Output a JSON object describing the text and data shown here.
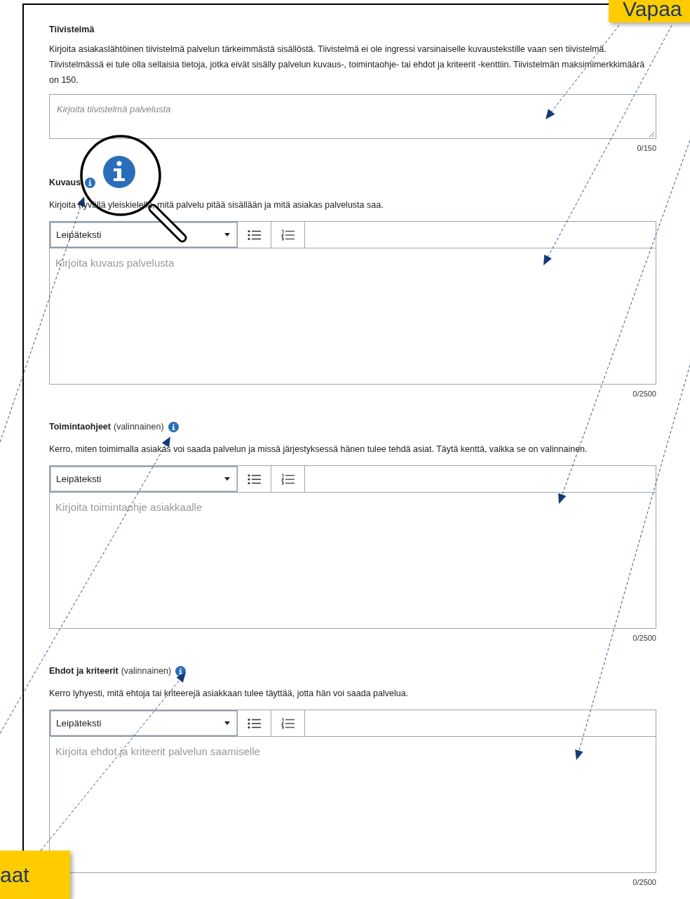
{
  "sections": [
    {
      "title": "Tiivistelmä",
      "info": false,
      "description": "Kirjoita asiakaslähtöinen tiivistelmä palvelun tärkeimmästä sisällöstä. Tiivistelmä ei ole ingressi varsinaiselle kuvaustekstille vaan sen tiivistelmä. Tiivistelmässä ei tule olla sellaisia tietoja, jotka eivät sisälly palvelun kuvaus-, toimintaohje- tai ehdot ja kriteerit -kenttiin. Tiivistelmän maksimimerkkimäärä on 150.",
      "kind": "textarea",
      "placeholder": "Kirjoita tiivistelmä palvelusta",
      "counter": "0/150"
    },
    {
      "title": "Kuvaus",
      "info": true,
      "description": "Kirjoita hyvällä yleiskielellä, mitä palvelu pitää sisällään ja mitä asiakas palvelusta saa.",
      "kind": "rich_text",
      "format": "Leipäteksti",
      "placeholder": "Kirjoita kuvaus palvelusta",
      "counter": "0/2500"
    },
    {
      "title": "Toimintaohjeet",
      "note": "(valinnainen)",
      "info": true,
      "description": "Kerro, miten toimimalla asiakas voi saada palvelun ja missä järjestyksessä hänen tulee tehdä asiat. Täytä kenttä, vaikka se on valinnainen.",
      "kind": "rich_text",
      "format": "Leipäteksti",
      "placeholder": "Kirjoita toimintaohje asiakkaalle",
      "counter": "0/2500"
    },
    {
      "title": "Ehdot ja kriteerit",
      "note": "(valinnainen)",
      "info": true,
      "description": "Kerro lyhyesti, mitä ehtoja tai kriteerejä asiakkaan tulee täyttää, jotta hän voi saada palvelua.",
      "kind": "rich_text",
      "format": "Leipäteksti",
      "placeholder": "Kirjoita ehdot ja kriteerit palvelun saamiselle",
      "counter": "0/2500"
    }
  ],
  "callouts": {
    "top_right": "Vapaa",
    "bottom_left": "aat"
  }
}
